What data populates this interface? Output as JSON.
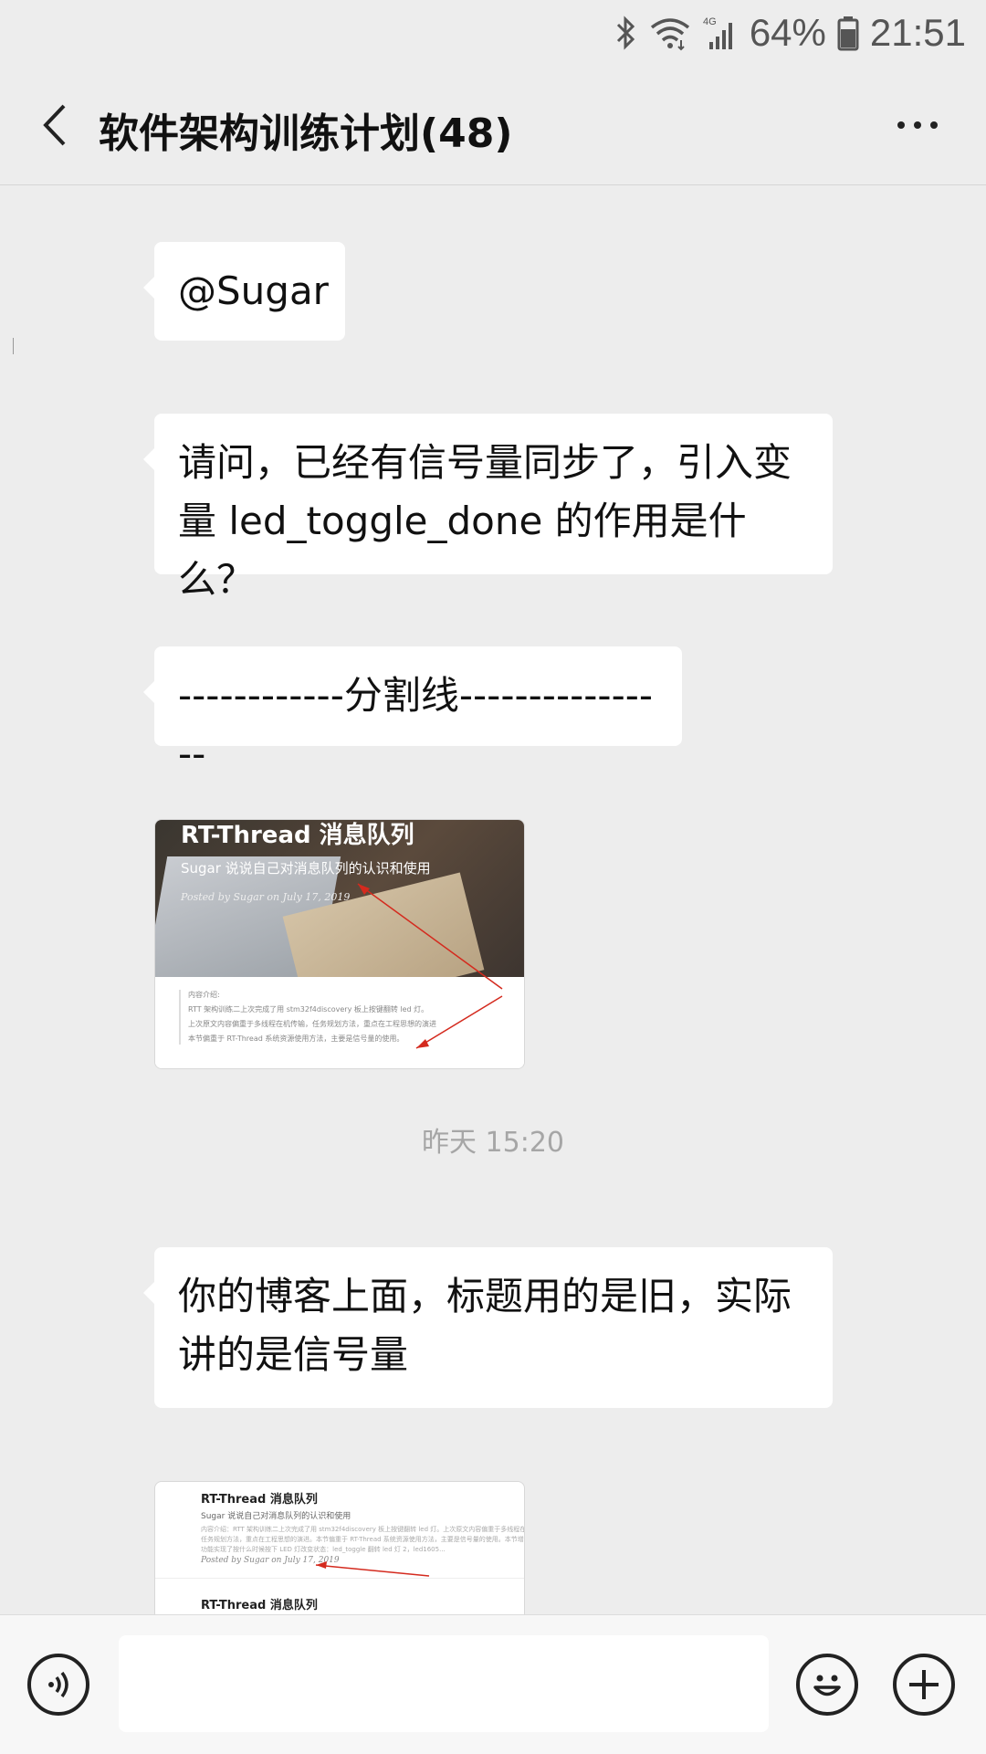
{
  "status_bar": {
    "battery": "64%",
    "time": "21:51",
    "network": "4G",
    "icons": [
      "bluetooth-icon",
      "wifi-icon",
      "cellular-signal-icon",
      "battery-icon"
    ]
  },
  "header": {
    "title": "软件架构训练计划(48)",
    "back_icon": "chevron-left-icon",
    "more_icon": "more-dots-icon"
  },
  "messages": [
    {
      "type": "text",
      "text": "@Sugar"
    },
    {
      "type": "text",
      "lines": [
        "请问，已经有信号量同步了，引入变",
        "量 led_toggle_done 的作用是什么？"
      ]
    },
    {
      "type": "text",
      "text": "------------分割线----------------"
    },
    {
      "type": "image",
      "title": "RT-Thread 消息队列",
      "subtitle": "Sugar 说说自己对消息队列的认识和使用",
      "posted": "Posted by Sugar on July 17, 2019",
      "body_lines": [
        "内容介绍:",
        "RTT 架构训练二上次完成了用 stm32f4discovery 板上按键翻转 led 灯。",
        "上次原文内容偏重于多线程在机传输，任务规划方法，重点在工程思想的演进",
        "本节偏重于 RT-Thread 系统资源使用方法，主要是信号量的使用。"
      ]
    },
    {
      "type": "time",
      "text": "昨天 15:20"
    },
    {
      "type": "text",
      "lines": [
        "你的博客上面，标题用的是旧，实际",
        "讲的是信号量"
      ]
    },
    {
      "type": "image",
      "title": "RT-Thread 消息队列",
      "subtitle": "Sugar 说说自己对消息队列的认识和使用",
      "small": "内容介绍：RTT 架构训练二上次完成了用 stm32f4discovery 板上按键翻转 led 灯。上次原文内容偏重于多线程在机传输",
      "small2": "任务规划方法，重点在工程思想的演进。本节偏重于 RT-Thread 系统资源使用方法，主要是信号量的使用。本节增加",
      "small3": "功能实现了按什么时候按下 LED 灯改变状态：led_toggle 翻转 led 灯 2，led1605...",
      "posted": "Posted by Sugar on July 17, 2019",
      "title2": "RT-Thread 消息队列"
    }
  ],
  "input_bar": {
    "voice_icon": "voice-icon",
    "emoji_icon": "emoji-icon",
    "plus_icon": "plus-icon",
    "input_value": ""
  }
}
